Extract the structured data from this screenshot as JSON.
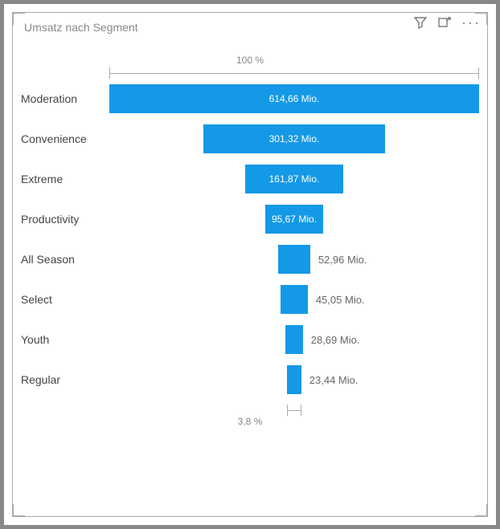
{
  "title": "Umsatz nach Segment",
  "toolbar": {
    "filter_icon": "filter-icon",
    "focus_icon": "focus-mode-icon",
    "more_icon": "more-options-icon"
  },
  "top_caliper_label": "100 %",
  "bottom_caliper_label": "3,8 %",
  "chart_data": {
    "type": "bar",
    "title": "Umsatz nach Segment",
    "xlabel": "",
    "ylabel": "",
    "unit": "Mio.",
    "top_percent": "100 %",
    "bottom_percent": "3,8 %",
    "categories": [
      "Moderation",
      "Convenience",
      "Extreme",
      "Productivity",
      "All Season",
      "Select",
      "Youth",
      "Regular"
    ],
    "values": [
      614.66,
      301.32,
      161.87,
      95.67,
      52.96,
      45.05,
      28.69,
      23.44
    ],
    "labels": [
      "614,66 Mio.",
      "301,32 Mio.",
      "161,87 Mio.",
      "95,67 Mio.",
      "52,96 Mio.",
      "45,05 Mio.",
      "28,69 Mio.",
      "23,44 Mio."
    ],
    "label_inside": [
      true,
      true,
      true,
      true,
      false,
      false,
      false,
      false
    ],
    "series": [
      {
        "name": "Umsatz",
        "color": "#1499e6",
        "values": [
          614.66,
          301.32,
          161.87,
          95.67,
          52.96,
          45.05,
          28.69,
          23.44
        ]
      }
    ],
    "xlim": [
      0,
      614.66
    ]
  }
}
